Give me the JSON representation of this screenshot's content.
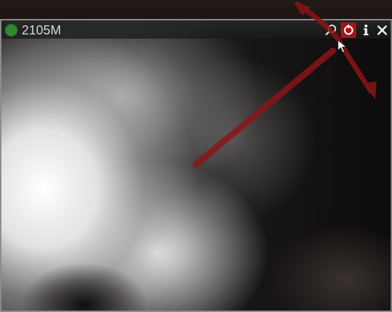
{
  "camera": {
    "name": "2105M",
    "status_color": "#2f8a2f"
  },
  "controls": {
    "search_icon": "magnifier-icon",
    "reset_icon": "rotate-reset-icon",
    "reset_active_color": "#a41518",
    "info_icon": "info-icon",
    "close_icon": "close-icon"
  },
  "annotation": {
    "arrow_color": "#8c1418"
  }
}
